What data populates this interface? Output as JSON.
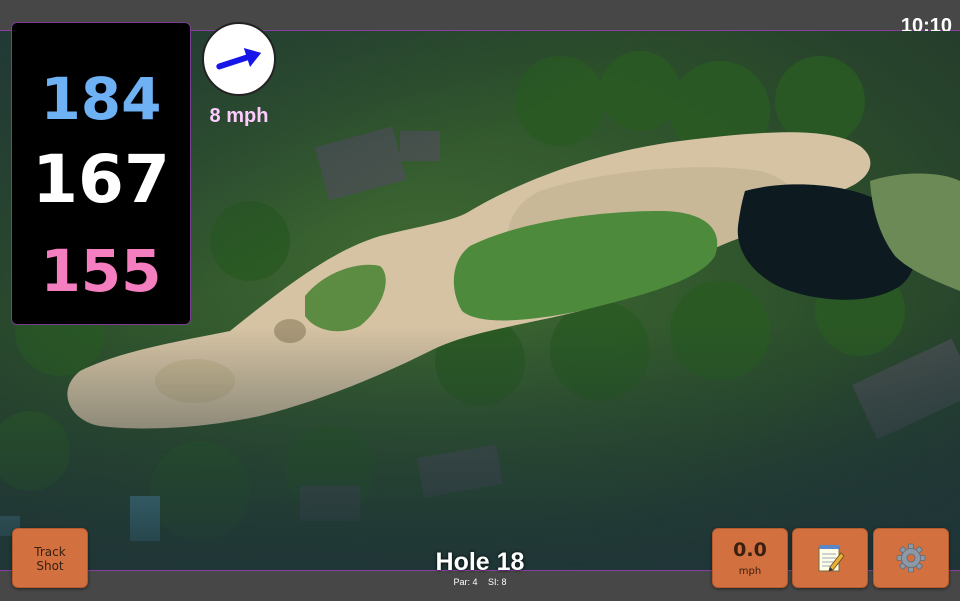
{
  "status_bar": {
    "time": "10:10"
  },
  "distances": {
    "back": "184",
    "middle": "167",
    "front": "155"
  },
  "wind": {
    "speed_label": "8 mph",
    "icon": "wind-direction-arrow-icon"
  },
  "hole": {
    "title": "Hole 18",
    "par_label": "Par: 4",
    "si_label": "SI: 8"
  },
  "buttons": {
    "track_shot_label": "Track\nShot",
    "speed_value": "0.0",
    "speed_unit": "mph",
    "notes_icon": "notepad-icon",
    "settings_icon": "gear-icon"
  },
  "colors": {
    "back_distance": "#6fb1f5",
    "middle_distance": "#ffffff",
    "front_distance": "#f47ec0",
    "button_bg": "#d3703f",
    "wind_label": "#ffccff",
    "bar_bg": "#474747",
    "accent_border": "#8a3fa0"
  }
}
